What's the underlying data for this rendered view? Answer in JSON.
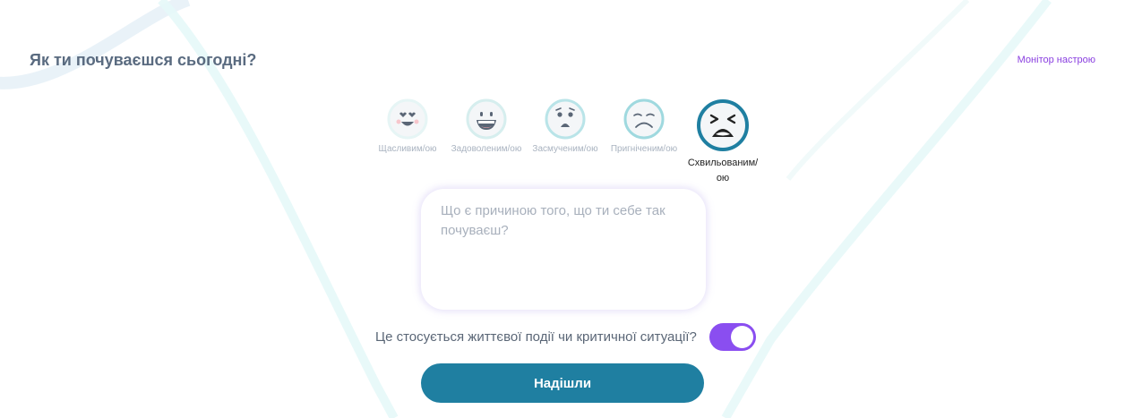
{
  "header": {
    "title": "Як ти почуваєшся сьогодні?",
    "monitor_link": "Монітор настрою"
  },
  "moods": [
    {
      "label": "Щасливим/ою",
      "icon": "happy-heart-eyes-face-icon",
      "selected": false
    },
    {
      "label": "Задоволеним/ою",
      "icon": "grinning-face-icon",
      "selected": false
    },
    {
      "label": "Засмученим/ою",
      "icon": "worried-face-icon",
      "selected": false
    },
    {
      "label": "Пригніченим/ою",
      "icon": "sad-face-icon",
      "selected": false
    },
    {
      "label": "Схвильованим/ою",
      "icon": "anxious-squint-face-icon",
      "selected": true
    }
  ],
  "reason_input": {
    "placeholder": "Що є причиною того, що ти себе так почуваєш?",
    "value": ""
  },
  "critical_toggle": {
    "label": "Це стосується життєвої події чи критичної ситуації?",
    "checked": true
  },
  "submit": {
    "label": "Надішли"
  },
  "colors": {
    "primary": "#1f7fa1",
    "accent": "#8a4ef0",
    "link": "#8a3fe0",
    "title": "#5a6b80"
  }
}
